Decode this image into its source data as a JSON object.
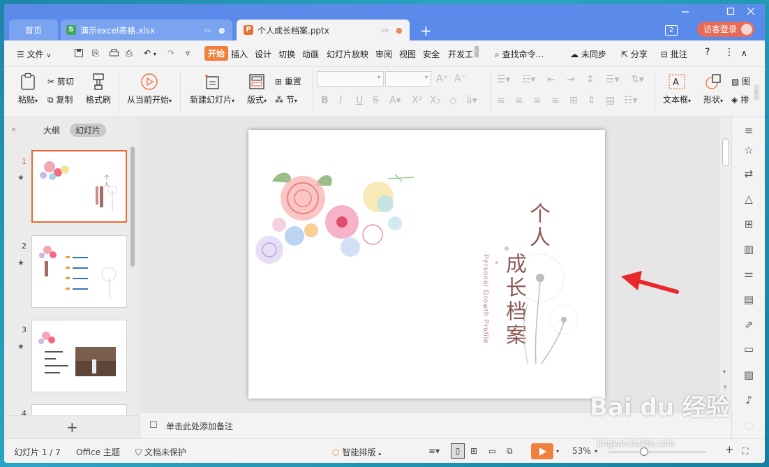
{
  "titlebar": {
    "tabs": [
      {
        "label": "首页"
      },
      {
        "label": "演示excel表格.xlsx",
        "icon": "S"
      },
      {
        "label": "个人成长档案.pptx",
        "icon": "P"
      }
    ],
    "window_badge": "2",
    "guest_login": "访客登录"
  },
  "menubar": {
    "file": "文件",
    "tabs": [
      "开始",
      "插入",
      "设计",
      "切换",
      "动画",
      "幻灯片放映",
      "审阅",
      "视图",
      "安全",
      "开发工"
    ],
    "search": "查找命令...",
    "sync": "未同步",
    "share": "分享",
    "comment": "批注"
  },
  "ribbon": {
    "paste": "粘贴",
    "cut": "剪切",
    "copy": "复制",
    "format_painter": "格式刷",
    "from_current": "从当前开始",
    "new_slide": "新建幻灯片",
    "layout": "版式",
    "reset": "重置",
    "section": "节",
    "textbox": "文本框",
    "shape": "形状",
    "picture_partial": "图",
    "arrange_partial": "排"
  },
  "left_panel": {
    "tab_outline": "大纲",
    "tab_slides": "幻灯片",
    "slide_numbers": [
      "1",
      "2",
      "3",
      "4"
    ]
  },
  "slide": {
    "title_line1": "个人",
    "title_line2": "成长档案",
    "subtitle": "Personal Growth Profile"
  },
  "notes": {
    "placeholder": "单击此处添加备注"
  },
  "status": {
    "slide_count": "幻灯片 1 / 7",
    "theme": "Office 主题",
    "protection": "文档未保护",
    "smart_layout": "智能排版",
    "zoom": "53%"
  },
  "watermark": {
    "brand": "Bai du 经验",
    "url": "jingyan.baidu.com"
  },
  "colors": {
    "titlebar": "#5a8bea",
    "accent": "#f0813d",
    "selected_slide": "#e86a35",
    "title_text": "#8c5a55",
    "guest_button": "#e86b5a"
  }
}
